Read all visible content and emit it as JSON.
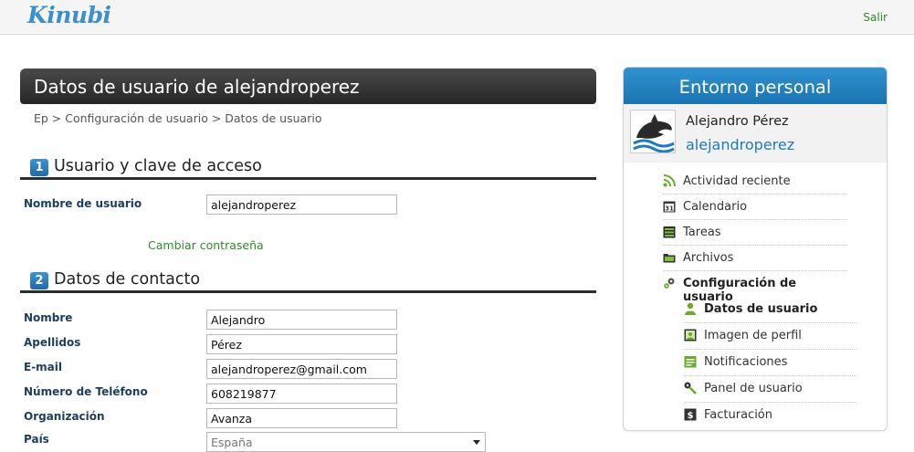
{
  "header": {
    "logo_text": "Kinubi",
    "logout_label": "Salir"
  },
  "page": {
    "title": "Datos de usuario de alejandroperez",
    "breadcrumb": "Ep > Configuración de usuario > Datos de usuario"
  },
  "section1": {
    "number": "1",
    "title": "Usuario y clave de acceso",
    "username_label": "Nombre de usuario",
    "username_value": "alejandroperez",
    "change_password": "Cambiar contraseña"
  },
  "section2": {
    "number": "2",
    "title": "Datos de contacto",
    "fields": [
      {
        "label": "Nombre",
        "value": "Alejandro"
      },
      {
        "label": "Apellidos",
        "value": "Pérez"
      },
      {
        "label": "E-mail",
        "value": "alejandroperez@gmail.com"
      },
      {
        "label": "Número de Teléfono",
        "value": "608219877"
      },
      {
        "label": "Organización",
        "value": "Avanza"
      },
      {
        "label": "País",
        "value": "España"
      }
    ]
  },
  "sidebar": {
    "title": "Entorno personal",
    "profile_name": "Alejandro Pérez",
    "profile_username": "alejandroperez",
    "items": [
      {
        "label": "Actividad reciente",
        "icon": "rss-icon"
      },
      {
        "label": "Calendario",
        "icon": "calendar-icon",
        "icon_text": "31"
      },
      {
        "label": "Tareas",
        "icon": "tasks-icon"
      },
      {
        "label": "Archivos",
        "icon": "folder-icon"
      },
      {
        "label": "Configuración de usuario",
        "icon": "gears-icon"
      }
    ],
    "subitems": [
      {
        "label": "Datos de usuario",
        "icon": "user-icon"
      },
      {
        "label": "Imagen de perfil",
        "icon": "profile-image-icon"
      },
      {
        "label": "Notificaciones",
        "icon": "notifications-icon"
      },
      {
        "label": "Panel de usuario",
        "icon": "key-icon"
      },
      {
        "label": "Facturación",
        "icon": "billing-icon",
        "icon_text": "$"
      }
    ]
  },
  "colors": {
    "accent_blue": "#1f7bbd",
    "link_green": "#2f8a2a",
    "label_navy": "#1c3d5e"
  }
}
